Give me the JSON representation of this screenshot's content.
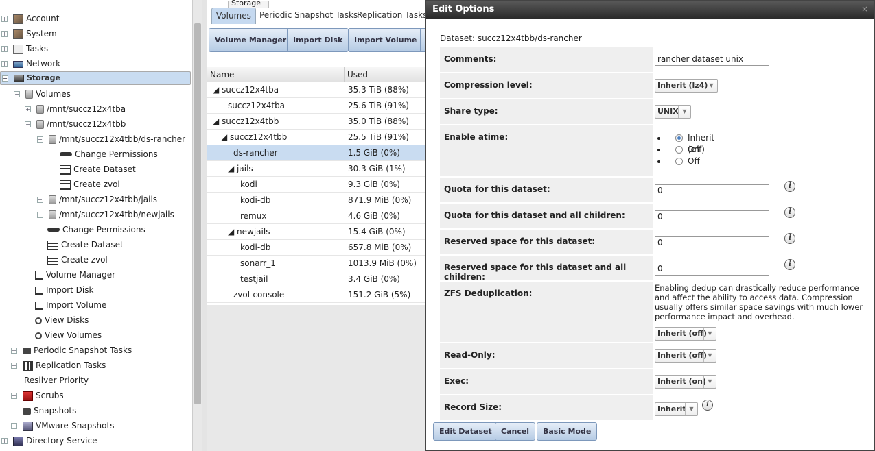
{
  "tree": [
    {
      "label": "Account",
      "expander": "+",
      "icon": "account-icon"
    },
    {
      "label": "System",
      "expander": "+",
      "icon": "system-icon"
    },
    {
      "label": "Tasks",
      "expander": "+",
      "icon": "tasks-icon"
    },
    {
      "label": "Network",
      "expander": "+",
      "icon": "network-icon"
    },
    {
      "label": "Storage",
      "expander": "-",
      "icon": "storage-icon"
    },
    {
      "label": "Volumes",
      "expander": "-",
      "icon": "database-icon"
    },
    {
      "label": "/mnt/succz12x4tba",
      "expander": "+",
      "icon": "database-icon"
    },
    {
      "label": "/mnt/succz12x4tbb",
      "expander": "-",
      "icon": "database-icon"
    },
    {
      "label": "/mnt/succz12x4tbb/ds-rancher",
      "expander": "-",
      "icon": "database-icon"
    },
    {
      "label": "Change Permissions",
      "expander": "",
      "icon": "key-icon"
    },
    {
      "label": "Create Dataset",
      "expander": "",
      "icon": "grid-icon"
    },
    {
      "label": "Create zvol",
      "expander": "",
      "icon": "grid-icon"
    },
    {
      "label": "/mnt/succz12x4tbb/jails",
      "expander": "+",
      "icon": "database-icon"
    },
    {
      "label": "/mnt/succz12x4tbb/newjails",
      "expander": "+",
      "icon": "database-icon"
    },
    {
      "label": "Change Permissions",
      "expander": "",
      "icon": "key-icon"
    },
    {
      "label": "Create Dataset",
      "expander": "",
      "icon": "grid-icon"
    },
    {
      "label": "Create zvol",
      "expander": "",
      "icon": "grid-icon"
    },
    {
      "label": "Volume Manager",
      "expander": "",
      "icon": "arrow-icon"
    },
    {
      "label": "Import Disk",
      "expander": "",
      "icon": "arrow-icon"
    },
    {
      "label": "Import Volume",
      "expander": "",
      "icon": "arrow-icon"
    },
    {
      "label": "View Disks",
      "expander": "",
      "icon": "magnifier-icon"
    },
    {
      "label": "View Volumes",
      "expander": "",
      "icon": "magnifier-icon"
    },
    {
      "label": "Periodic Snapshot Tasks",
      "expander": "+",
      "icon": "snapshot-task-icon"
    },
    {
      "label": "Replication Tasks",
      "expander": "+",
      "icon": "replication-icon"
    },
    {
      "label": "Resilver Priority",
      "expander": "",
      "icon": ""
    },
    {
      "label": "Scrubs",
      "expander": "+",
      "icon": "scrub-icon"
    },
    {
      "label": "Snapshots",
      "expander": "",
      "icon": "lock-icon"
    },
    {
      "label": "VMware-Snapshots",
      "expander": "+",
      "icon": "vmware-icon"
    },
    {
      "label": "Directory Service",
      "expander": "+",
      "icon": "directory-icon"
    }
  ],
  "tabs": {
    "storage": "Storage",
    "volumes": "Volumes",
    "periodic": "Periodic Snapshot Tasks",
    "replication": "Replication Tasks"
  },
  "toolbar": {
    "volume_manager": "Volume Manager",
    "import_disk": "Import Disk",
    "import_volume": "Import Volume"
  },
  "grid": {
    "col_name": "Name",
    "col_used": "Used",
    "rows": [
      {
        "name": "◢ succz12x4tba",
        "used": "35.3 TiB (88%)"
      },
      {
        "name": "succz12x4tba",
        "used": "25.6 TiB (91%)"
      },
      {
        "name": "◢ succz12x4tbb",
        "used": "35.0 TiB (88%)"
      },
      {
        "name": "◢ succz12x4tbb",
        "used": "25.5 TiB (91%)"
      },
      {
        "name": "ds-rancher",
        "used": "1.5 GiB (0%)"
      },
      {
        "name": "◢ jails",
        "used": "30.3 GiB (1%)"
      },
      {
        "name": "kodi",
        "used": "9.3 GiB (0%)"
      },
      {
        "name": "kodi-db",
        "used": "871.9 MiB (0%)"
      },
      {
        "name": "remux",
        "used": "4.6 GiB (0%)"
      },
      {
        "name": "◢ newjails",
        "used": "15.4 GiB (0%)"
      },
      {
        "name": "kodi-db",
        "used": "657.8 MiB (0%)"
      },
      {
        "name": "sonarr_1",
        "used": "1013.9 MiB (0%)"
      },
      {
        "name": "testjail",
        "used": "3.4 GiB (0%)"
      },
      {
        "name": "zvol-console",
        "used": "151.2 GiB (5%)"
      }
    ]
  },
  "dialog": {
    "title": "Edit Options",
    "close": "×",
    "dataset": "Dataset: succz12x4tbb/ds-rancher",
    "comments_label": "Comments:",
    "comments_value": "rancher dataset unix",
    "compression_label": "Compression level:",
    "compression_value": "Inherit (lz4)",
    "share_label": "Share type:",
    "share_value": "UNIX",
    "atime_label": "Enable atime:",
    "atime_options": [
      "Inherit (off)",
      "On",
      "Off"
    ],
    "quota_label": "Quota for this dataset:",
    "quota_value": "0",
    "quota_all_label": "Quota for this dataset and all children:",
    "quota_all_value": "0",
    "reserved_label": "Reserved space for this dataset:",
    "reserved_value": "0",
    "reserved_all_label": "Reserved space for this dataset and all children:",
    "reserved_all_value": "0",
    "dedup_label": "ZFS Deduplication:",
    "dedup_text": "Enabling dedup can drastically reduce performance and affect the ability to access data. Compression usually offers similar space savings with much lower performance impact and overhead.",
    "dedup_value": "Inherit (off)",
    "readonly_label": "Read-Only:",
    "readonly_value": "Inherit (off)",
    "exec_label": "Exec:",
    "exec_value": "Inherit (on)",
    "recordsize_label": "Record Size:",
    "recordsize_value": "Inherit",
    "info_glyph": "i",
    "edit_button": "Edit Dataset",
    "cancel_button": "Cancel",
    "basic_button": "Basic Mode"
  }
}
